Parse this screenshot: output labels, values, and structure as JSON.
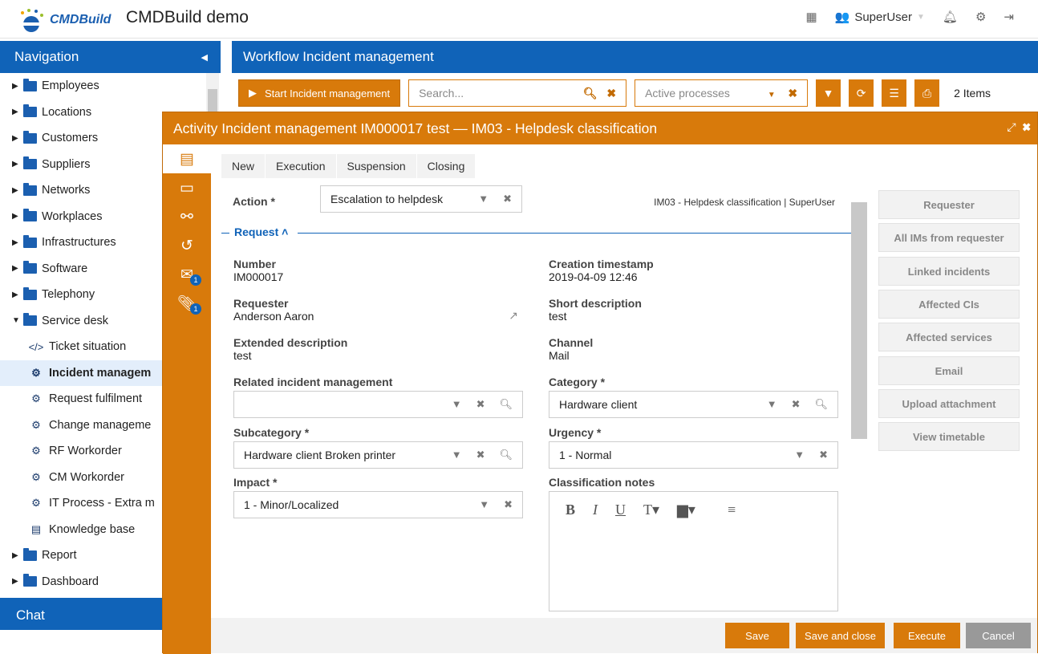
{
  "app": {
    "logo_text": "CMDBuild",
    "title": "CMDBuild demo",
    "user": "SuperUser"
  },
  "nav": {
    "title": "Navigation",
    "items": [
      {
        "label": "Employees",
        "kind": "folder"
      },
      {
        "label": "Locations",
        "kind": "folder"
      },
      {
        "label": "Customers",
        "kind": "folder"
      },
      {
        "label": "Suppliers",
        "kind": "folder"
      },
      {
        "label": "Networks",
        "kind": "folder"
      },
      {
        "label": "Workplaces",
        "kind": "folder"
      },
      {
        "label": "Infrastructures",
        "kind": "folder"
      },
      {
        "label": "Software",
        "kind": "folder"
      },
      {
        "label": "Telephony",
        "kind": "folder"
      },
      {
        "label": "Service desk",
        "kind": "folder-open"
      },
      {
        "label": "Ticket situation",
        "kind": "code"
      },
      {
        "label": "Incident managem",
        "kind": "gear"
      },
      {
        "label": "Request fulfilment",
        "kind": "gear"
      },
      {
        "label": "Change manageme",
        "kind": "gear"
      },
      {
        "label": "RF Workorder",
        "kind": "gear"
      },
      {
        "label": "CM Workorder",
        "kind": "gear"
      },
      {
        "label": "IT Process - Extra m",
        "kind": "gear"
      },
      {
        "label": "Knowledge base",
        "kind": "doc"
      },
      {
        "label": "Report",
        "kind": "folder"
      },
      {
        "label": "Dashboard",
        "kind": "folder"
      }
    ],
    "chat": "Chat"
  },
  "main": {
    "title": "Workflow Incident management",
    "start_label": "Start Incident management",
    "search_placeholder": "Search...",
    "filter_value": "Active processes",
    "items_count": "2 Items"
  },
  "modal": {
    "title": "Activity Incident management IM000017 test — IM03 - Helpdesk classification",
    "steps": [
      "New",
      "Execution",
      "Suspension",
      "Closing"
    ],
    "action_label": "Action *",
    "action_value": "Escalation to helpdesk",
    "context": "IM03 - Helpdesk classification | SuperUser",
    "section": "Request",
    "fields": {
      "number_label": "Number",
      "number": "IM000017",
      "created_label": "Creation timestamp",
      "created": "2019-04-09 12:46",
      "requester_label": "Requester",
      "requester": "Anderson Aaron",
      "short_label": "Short description",
      "short": "test",
      "ext_label": "Extended description",
      "ext": "test",
      "channel_label": "Channel",
      "channel": "Mail",
      "related_label": "Related incident management",
      "related": "",
      "category_label": "Category *",
      "category": "Hardware client",
      "subcat_label": "Subcategory *",
      "subcat": "Hardware client Broken printer",
      "urgency_label": "Urgency *",
      "urgency": "1 - Normal",
      "impact_label": "Impact *",
      "impact": "1 - Minor/Localized",
      "notes_label": "Classification notes"
    },
    "right_buttons": [
      "Requester",
      "All IMs from requester",
      "Linked incidents",
      "Affected CIs",
      "Affected services",
      "Email",
      "Upload attachment",
      "View timetable"
    ],
    "footer": {
      "save": "Save",
      "save_close": "Save and close",
      "execute": "Execute",
      "cancel": "Cancel"
    },
    "badges": {
      "email": "1",
      "attachments": "1"
    }
  },
  "colors": {
    "brand_blue": "#1063b8",
    "accent_orange": "#d87a0b"
  }
}
